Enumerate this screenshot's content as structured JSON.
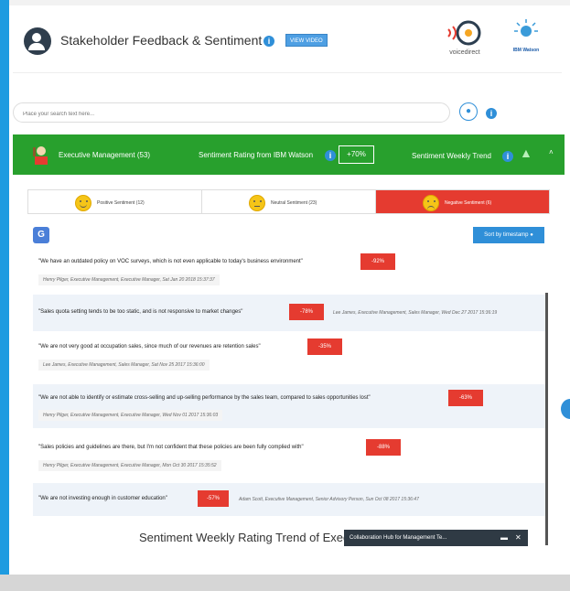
{
  "header": {
    "title": "Stakeholder Feedback & Sentiment",
    "view_video": "VIEW VIDEO",
    "logo_voice": "voicedirect",
    "logo_watson": "IBM Watson"
  },
  "search": {
    "placeholder": "Place your search text here..."
  },
  "exec": {
    "title": "Executive Management (53)",
    "rating_label": "Sentiment Rating from IBM Watson",
    "rating_value": "+70%",
    "trend_label": "Sentiment Weekly Trend"
  },
  "tabs": [
    {
      "label": "Positive Sentiment (12)"
    },
    {
      "label": "Neutral Sentiment (23)"
    },
    {
      "label": "Negative Sentiment (6)"
    }
  ],
  "sort_label": "Sort by timestamp",
  "feedback": [
    {
      "quote": "\"We have an outdated policy on VOC surveys, which is not even applicable to today's business environment\"",
      "score": "-92%",
      "meta": "Henry Pilger, Executive Management, Executive Manager, Sat Jan 20 2018 15:37:37"
    },
    {
      "quote": "\"Sales quota setting tends to be too static, and is not responsive to market changes\"",
      "score": "-78%",
      "meta": "Lee James, Executive Management, Sales Manager, Wed Dec 27 2017 15:36:19"
    },
    {
      "quote": "\"We are not very good at occupation sales, since much of our revenues are retention sales\"",
      "score": "-35%",
      "meta": "Lee James, Executive Management, Sales Manager, Sat Nov 25 2017 15:36:00"
    },
    {
      "quote": "\"We are not able to identify or estimate cross-selling and up-selling performance by the sales team, compared to sales opportunities lost\"",
      "score": "-63%",
      "meta": "Henry Pilger, Executive Management, Executive Manager, Wed Nov 01 2017 15:36:03"
    },
    {
      "quote": "\"Sales policies and guidelines are there, but I'm not confident that these policies are been fully complied with\"",
      "score": "-88%",
      "meta": "Henry Pilger, Executive Management, Executive Manager, Mon Oct 30 2017 15:35:52"
    },
    {
      "quote": "\"We are not investing enough in customer education\"",
      "score": "-57%",
      "meta": "Adam Scott, Executive Management, Senior Advisory Person, Sun Oct 08 2017 15:36:47"
    }
  ],
  "chart_title": "Sentiment Weekly Rating Trend of Executive Management",
  "chat": {
    "title": "Collaboration Hub for Management Te..."
  },
  "colors": {
    "accent": "#2f8fd8",
    "green": "#28a02d",
    "negative": "#e53b30"
  }
}
